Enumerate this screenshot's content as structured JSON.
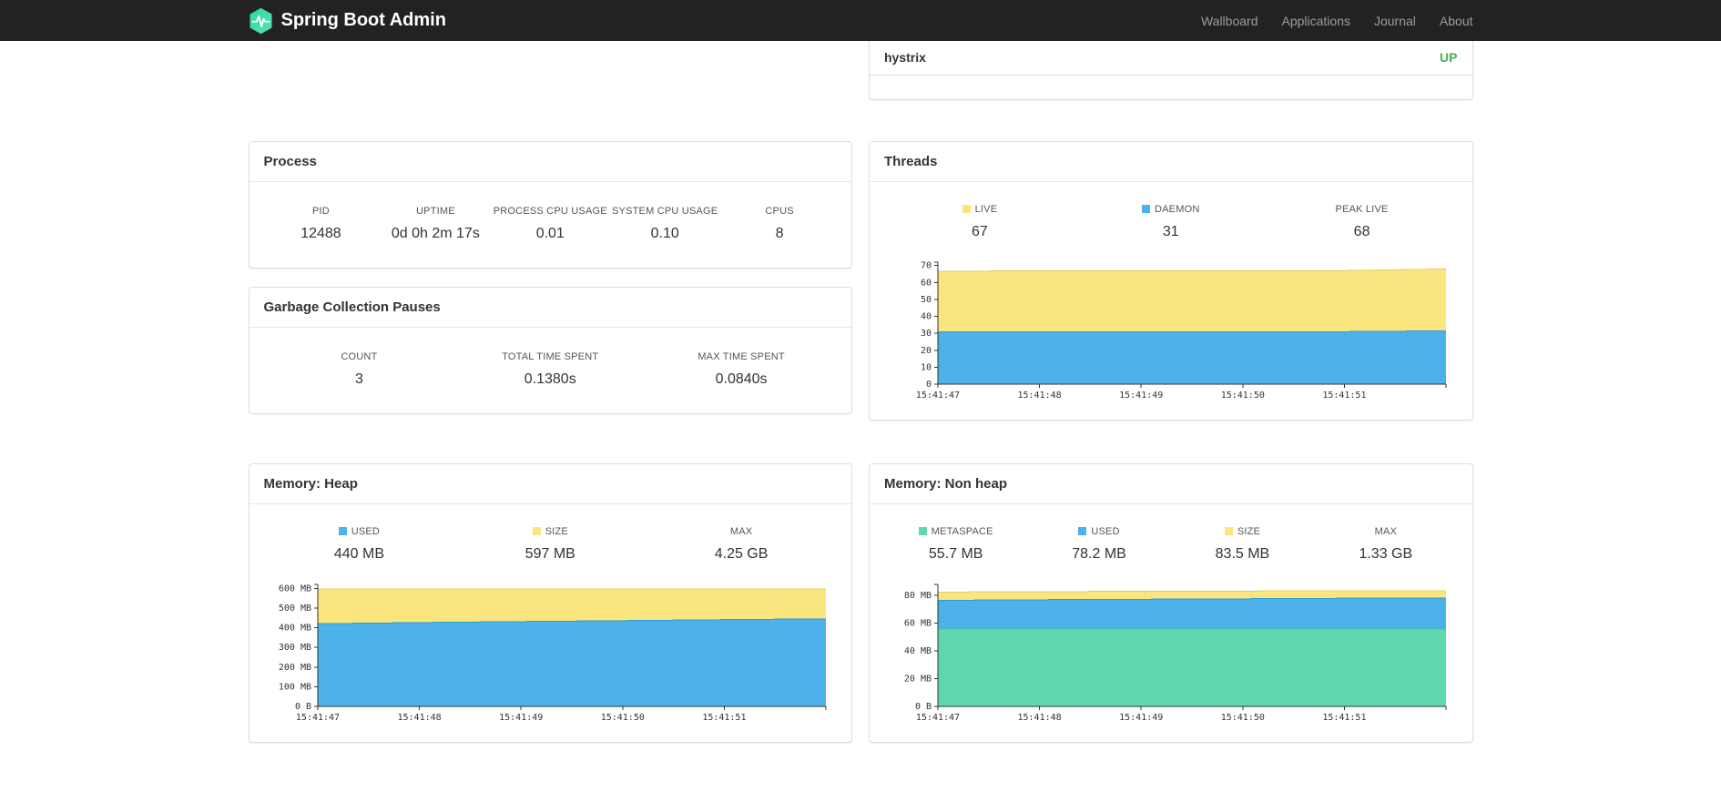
{
  "navbar": {
    "brand": "Spring Boot Admin",
    "links": [
      {
        "label": "Wallboard"
      },
      {
        "label": "Applications"
      },
      {
        "label": "Journal"
      },
      {
        "label": "About"
      }
    ]
  },
  "colors": {
    "status_up": "#4caf50",
    "series_yellow": "#fbe57e",
    "series_blue": "#4cb2e9",
    "series_green": "#5fd8ad",
    "logo_green_1": "#2ed8a3",
    "logo_green_2": "#59e3ae"
  },
  "application_status": {
    "service": "hystrix",
    "status": "UP"
  },
  "panels": {
    "process": {
      "title": "Process",
      "stats": [
        {
          "label": "PID",
          "value": "12488"
        },
        {
          "label": "UPTIME",
          "value": "0d 0h 2m 17s"
        },
        {
          "label": "PROCESS CPU USAGE",
          "value": "0.01"
        },
        {
          "label": "SYSTEM CPU USAGE",
          "value": "0.10"
        },
        {
          "label": "CPUS",
          "value": "8"
        }
      ]
    },
    "gc": {
      "title": "Garbage Collection Pauses",
      "stats": [
        {
          "label": "COUNT",
          "value": "3"
        },
        {
          "label": "TOTAL TIME SPENT",
          "value": "0.1380s"
        },
        {
          "label": "MAX TIME SPENT",
          "value": "0.0840s"
        }
      ]
    },
    "threads": {
      "title": "Threads",
      "legend": [
        {
          "label": "LIVE",
          "value": "67",
          "color": "#fbe57e"
        },
        {
          "label": "DAEMON",
          "value": "31",
          "color": "#4cb2e9"
        },
        {
          "label": "PEAK LIVE",
          "value": "68",
          "color": ""
        }
      ]
    },
    "memory_heap": {
      "title": "Memory: Heap",
      "legend": [
        {
          "label": "USED",
          "value": "440 MB",
          "color": "#4cb2e9"
        },
        {
          "label": "SIZE",
          "value": "597 MB",
          "color": "#fbe57e"
        },
        {
          "label": "MAX",
          "value": "4.25 GB",
          "color": ""
        }
      ]
    },
    "memory_nonheap": {
      "title": "Memory: Non heap",
      "legend": [
        {
          "label": "METASPACE",
          "value": "55.7 MB",
          "color": "#5fd8ad"
        },
        {
          "label": "USED",
          "value": "78.2 MB",
          "color": "#4cb2e9"
        },
        {
          "label": "SIZE",
          "value": "83.5 MB",
          "color": "#fbe57e"
        },
        {
          "label": "MAX",
          "value": "1.33 GB",
          "color": ""
        }
      ]
    }
  },
  "chart_data": [
    {
      "id": "threads",
      "type": "area",
      "title": "Threads",
      "x_labels": [
        "15:41:47",
        "15:41:48",
        "15:41:49",
        "15:41:50",
        "15:41:51"
      ],
      "ylim": [
        0,
        72
      ],
      "yticks": [
        {
          "v": 0,
          "label": "0"
        },
        {
          "v": 10,
          "label": "10"
        },
        {
          "v": 20,
          "label": "20"
        },
        {
          "v": 30,
          "label": "30"
        },
        {
          "v": 40,
          "label": "40"
        },
        {
          "v": 50,
          "label": "50"
        },
        {
          "v": 60,
          "label": "60"
        },
        {
          "v": 70,
          "label": "70"
        }
      ],
      "series": [
        {
          "name": "LIVE",
          "color": "#fbe57e",
          "edge": "#e3cd62",
          "values": [
            66.5,
            67,
            67,
            67,
            67,
            68
          ]
        },
        {
          "name": "DAEMON",
          "color": "#4cb2e9",
          "edge": "#2e9ad6",
          "values": [
            31,
            31,
            31,
            31,
            31,
            31.5
          ]
        }
      ]
    },
    {
      "id": "memory_heap",
      "type": "area",
      "title": "Memory: Heap",
      "x_labels": [
        "15:41:47",
        "15:41:48",
        "15:41:49",
        "15:41:50",
        "15:41:51"
      ],
      "ylim": [
        0,
        620
      ],
      "yticks": [
        {
          "v": 0,
          "label": "0 B"
        },
        {
          "v": 100,
          "label": "100 MB"
        },
        {
          "v": 200,
          "label": "200 MB"
        },
        {
          "v": 300,
          "label": "300 MB"
        },
        {
          "v": 400,
          "label": "400 MB"
        },
        {
          "v": 500,
          "label": "500 MB"
        },
        {
          "v": 600,
          "label": "600 MB"
        }
      ],
      "series": [
        {
          "name": "SIZE",
          "color": "#fbe57e",
          "edge": "#e3cd62",
          "values": [
            597,
            597,
            597,
            597,
            597,
            597
          ]
        },
        {
          "name": "USED",
          "color": "#4cb2e9",
          "edge": "#2e9ad6",
          "values": [
            420,
            426,
            431,
            436,
            441,
            445
          ]
        }
      ]
    },
    {
      "id": "memory_nonheap",
      "type": "area",
      "title": "Memory: Non heap",
      "x_labels": [
        "15:41:47",
        "15:41:48",
        "15:41:49",
        "15:41:50",
        "15:41:51"
      ],
      "ylim": [
        0,
        88
      ],
      "yticks": [
        {
          "v": 0,
          "label": "0 B"
        },
        {
          "v": 20,
          "label": "20 MB"
        },
        {
          "v": 40,
          "label": "40 MB"
        },
        {
          "v": 60,
          "label": "60 MB"
        },
        {
          "v": 80,
          "label": "80 MB"
        }
      ],
      "series": [
        {
          "name": "SIZE",
          "color": "#fbe57e",
          "edge": "#e3cd62",
          "values": [
            82.5,
            82.8,
            83,
            83.2,
            83.4,
            83.5
          ]
        },
        {
          "name": "USED",
          "color": "#4cb2e9",
          "edge": "#2e9ad6",
          "values": [
            76.5,
            77,
            77.3,
            77.6,
            78,
            78.2
          ]
        },
        {
          "name": "METASPACE",
          "color": "#5fd8ad",
          "edge": "#45c596",
          "values": [
            55.7,
            55.7,
            55.7,
            55.7,
            55.7,
            55.7
          ]
        }
      ]
    }
  ]
}
